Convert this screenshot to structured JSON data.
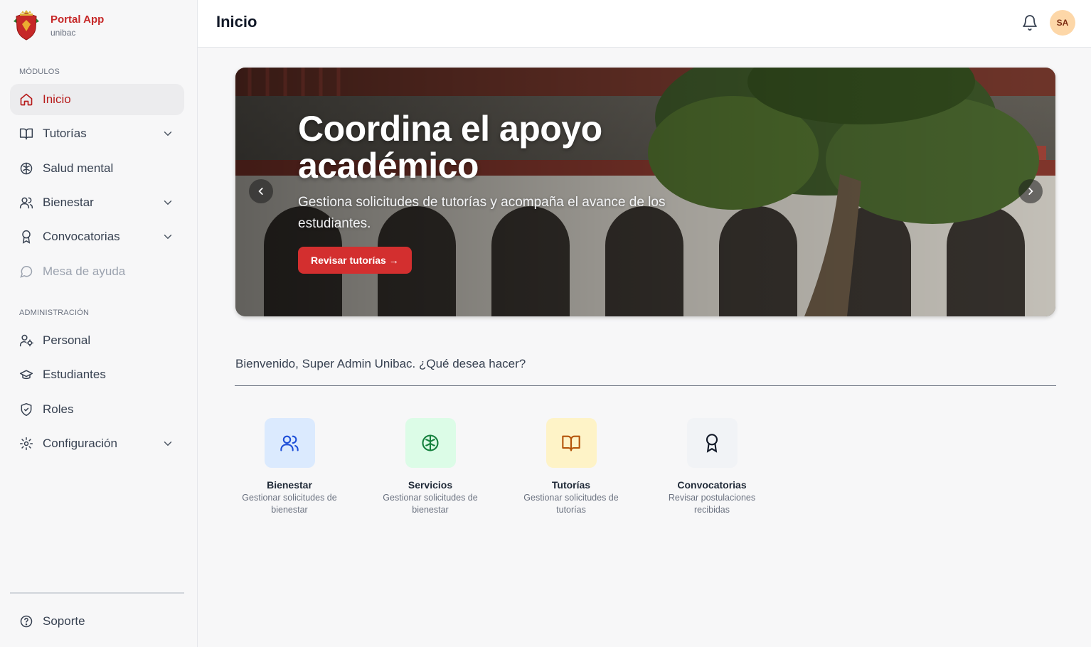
{
  "brand": {
    "title": "Portal App",
    "subtitle": "unibac"
  },
  "sidebar": {
    "modules_label": "MÓDULOS",
    "admin_label": "ADMINISTRACIÓN",
    "modules": [
      {
        "label": "Inicio",
        "icon": "home-icon",
        "active": true
      },
      {
        "label": "Tutorías",
        "icon": "book-open-icon",
        "expandable": true
      },
      {
        "label": "Salud mental",
        "icon": "brain-icon"
      },
      {
        "label": "Bienestar",
        "icon": "users-icon",
        "expandable": true
      },
      {
        "label": "Convocatorias",
        "icon": "award-icon",
        "expandable": true
      },
      {
        "label": "Mesa de ayuda",
        "icon": "message-circle-icon",
        "disabled": true
      }
    ],
    "admin": [
      {
        "label": "Personal",
        "icon": "user-cog-icon"
      },
      {
        "label": "Estudiantes",
        "icon": "graduation-cap-icon"
      },
      {
        "label": "Roles",
        "icon": "shield-check-icon"
      },
      {
        "label": "Configuración",
        "icon": "settings-icon",
        "expandable": true
      }
    ],
    "support": {
      "label": "Soporte",
      "icon": "help-circle-icon"
    }
  },
  "header": {
    "title": "Inicio",
    "avatar_initials": "SA",
    "bell_icon": "bell-icon"
  },
  "hero": {
    "title": "Coordina el apoyo académico",
    "subtitle": "Gestiona solicitudes de tutorías y acompaña el avance de los estudiantes.",
    "button_label": "Revisar tutorías →",
    "button_color": "#d32f2f"
  },
  "welcome": "Bienvenido, Super Admin Unibac. ¿Qué desea hacer?",
  "quick_actions": [
    {
      "title": "Bienestar",
      "desc": "Gestionar solicitudes de bienestar",
      "icon": "users-icon",
      "bg": "#dbeafe",
      "fg": "#1d4ed8"
    },
    {
      "title": "Servicios",
      "desc": "Gestionar solicitudes de bienestar",
      "icon": "brain-icon",
      "bg": "#dcfce7",
      "fg": "#15803d"
    },
    {
      "title": "Tutorías",
      "desc": "Gestionar solicitudes de tutorías",
      "icon": "book-open-icon",
      "bg": "#fef3c7",
      "fg": "#b45309"
    },
    {
      "title": "Convocatorias",
      "desc": "Revisar postulaciones recibidas",
      "icon": "award-icon",
      "bg": "#f1f3f6",
      "fg": "#111827"
    }
  ],
  "colors": {
    "accent": "#b71c1c",
    "brand": "#c62828"
  }
}
